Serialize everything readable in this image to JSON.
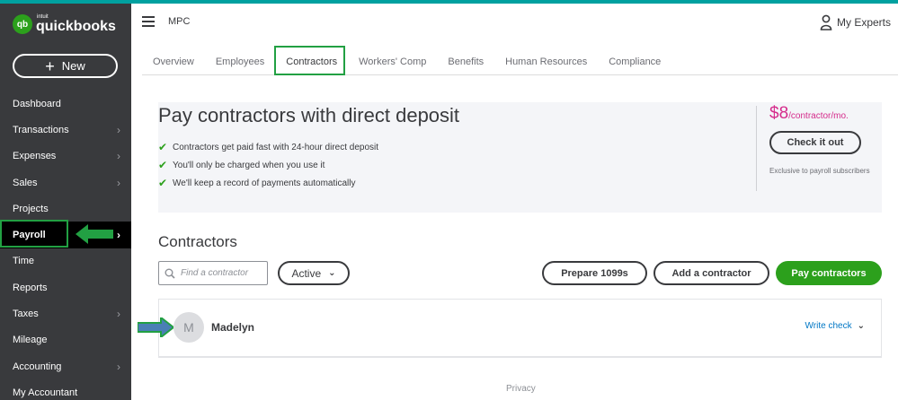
{
  "brand": {
    "intuit": "intuit",
    "name": "quickbooks",
    "badge": "qb",
    "colors": {
      "green": "#2ca01c",
      "sidebar": "#393a3d",
      "accent_pink": "#d52b8b",
      "link": "#0077c5",
      "highlight_box": "#22a043"
    }
  },
  "sidebar": {
    "new_label": "New",
    "items": [
      {
        "label": "Dashboard",
        "chevron": false
      },
      {
        "label": "Transactions",
        "chevron": true
      },
      {
        "label": "Expenses",
        "chevron": true
      },
      {
        "label": "Sales",
        "chevron": true
      },
      {
        "label": "Projects",
        "chevron": false
      },
      {
        "label": "Payroll",
        "chevron": true,
        "active": true
      },
      {
        "label": "Time",
        "chevron": false
      },
      {
        "label": "Reports",
        "chevron": false
      },
      {
        "label": "Taxes",
        "chevron": true
      },
      {
        "label": "Mileage",
        "chevron": false
      },
      {
        "label": "Accounting",
        "chevron": true
      },
      {
        "label": "My Accountant",
        "chevron": false
      }
    ]
  },
  "header": {
    "company": "MPC",
    "experts_label": "My Experts"
  },
  "tabs": [
    {
      "label": "Overview"
    },
    {
      "label": "Employees"
    },
    {
      "label": "Contractors",
      "active": true
    },
    {
      "label": "Workers' Comp"
    },
    {
      "label": "Benefits"
    },
    {
      "label": "Human Resources"
    },
    {
      "label": "Compliance"
    }
  ],
  "promo": {
    "title": "Pay contractors with direct deposit",
    "bullets": [
      "Contractors get paid fast with 24-hour direct deposit",
      "You'll only be charged when you use it",
      "We'll keep a record of payments automatically"
    ],
    "price": "$8",
    "price_unit": "/contractor/mo.",
    "cta": "Check it out",
    "note": "Exclusive to payroll subscribers"
  },
  "contractors": {
    "title": "Contractors",
    "search_placeholder": "Find a contractor",
    "filter_value": "Active",
    "prepare_label": "Prepare 1099s",
    "add_label": "Add a contractor",
    "pay_label": "Pay contractors",
    "rows": [
      {
        "initial": "M",
        "name": "Madelyn",
        "action": "Write check"
      }
    ]
  },
  "footer": {
    "privacy": "Privacy"
  }
}
